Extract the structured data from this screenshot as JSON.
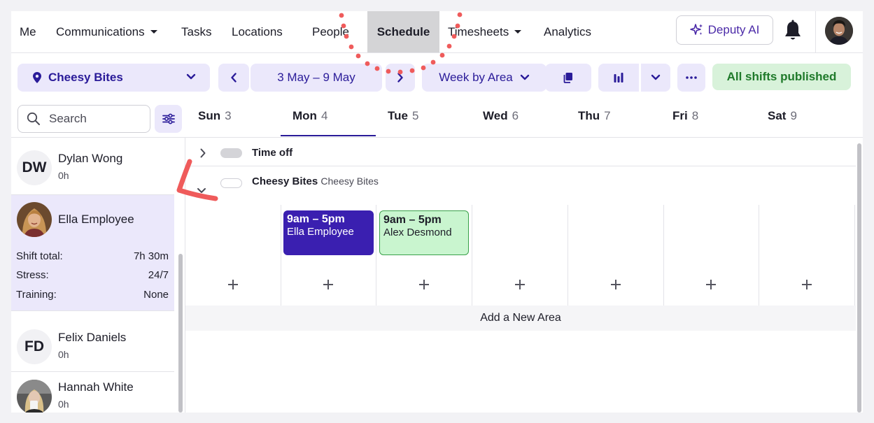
{
  "nav": {
    "items": [
      {
        "label": "Me"
      },
      {
        "label": "Communications",
        "has_caret": true
      },
      {
        "label": "Tasks"
      },
      {
        "label": "Locations"
      },
      {
        "label": "People"
      },
      {
        "label": "Schedule",
        "active": true
      },
      {
        "label": "Timesheets",
        "has_caret": true
      },
      {
        "label": "Analytics"
      }
    ],
    "ai_button": "Deputy AI",
    "icons": [
      "sparkle-icon",
      "bell-icon",
      "user-avatar"
    ]
  },
  "toolbar": {
    "location": "Cheesy Bites",
    "date_range": "3 May – 9 May",
    "view_mode": "Week by Area",
    "publish_status": "All shifts published",
    "icons": [
      "map-pin-icon",
      "chevron-down-icon",
      "chevron-left-icon",
      "chevron-right-icon",
      "copy-icon",
      "bar-chart-icon",
      "more-icon"
    ]
  },
  "search": {
    "placeholder": "Search"
  },
  "days": [
    {
      "name": "Sun",
      "date": "3"
    },
    {
      "name": "Mon",
      "date": "4",
      "selected": true
    },
    {
      "name": "Tue",
      "date": "5"
    },
    {
      "name": "Wed",
      "date": "6"
    },
    {
      "name": "Thu",
      "date": "7"
    },
    {
      "name": "Fri",
      "date": "8"
    },
    {
      "name": "Sat",
      "date": "9"
    }
  ],
  "employees": [
    {
      "initials": "DW",
      "name": "Dylan Wong",
      "hours": "0h"
    },
    {
      "name": "Ella Employee",
      "selected": true,
      "stats": [
        {
          "label": "Shift total:",
          "value": "7h 30m"
        },
        {
          "label": "Stress:",
          "value": "24/7"
        },
        {
          "label": "Training:",
          "value": "None"
        }
      ]
    },
    {
      "initials": "FD",
      "name": "Felix Daniels",
      "hours": "0h"
    },
    {
      "name": "Hannah White",
      "hours": "0h"
    }
  ],
  "schedule": {
    "time_off_label": "Time off",
    "area_name": "Cheesy Bites",
    "area_location": "Cheesy Bites",
    "shifts": [
      {
        "time": "9am – 5pm",
        "person": "Ella Employee",
        "day": "Mon",
        "color": "#3a1fb0",
        "text_color": "#ffffff"
      },
      {
        "time": "9am – 5pm",
        "person": "Alex Desmond",
        "day": "Tue",
        "color": "#c9f5cf",
        "text_color": "#1d1d28"
      }
    ],
    "add_area_label": "Add a New Area"
  },
  "colors": {
    "accent": "#2a1b99",
    "accent_soft": "#ebe8fb",
    "published_bg": "#d8f2da",
    "published_text": "#1f7a2a",
    "annotation": "#ef5b5b"
  }
}
